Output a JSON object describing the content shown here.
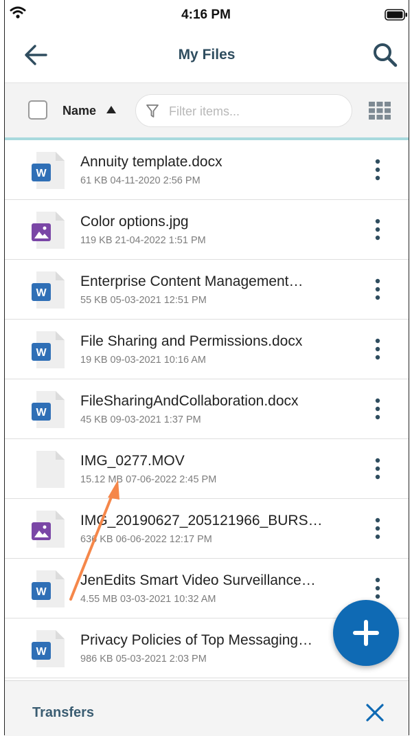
{
  "status_bar": {
    "time": "4:16 PM"
  },
  "header": {
    "title": "My Files"
  },
  "toolbar": {
    "sort_label": "Name",
    "filter_placeholder": "Filter items..."
  },
  "files": [
    {
      "name": "Annuity template.docx",
      "meta": "61 KB 04-11-2020 2:56 PM",
      "icon": "word-doc-icon"
    },
    {
      "name": "Color options.jpg",
      "meta": "119 KB 21-04-2022 1:51 PM",
      "icon": "image-file-icon"
    },
    {
      "name": "Enterprise Content Management…",
      "meta": "55 KB 05-03-2021 12:51 PM",
      "icon": "word-doc-icon"
    },
    {
      "name": "File Sharing and Permissions.docx",
      "meta": "19 KB 09-03-2021 10:16 AM",
      "icon": "word-doc-icon"
    },
    {
      "name": "FileSharingAndCollaboration.docx",
      "meta": "45 KB 09-03-2021 1:37 PM",
      "icon": "word-doc-icon"
    },
    {
      "name": "IMG_0277.MOV",
      "meta": "15.12 MB 07-06-2022 2:45 PM",
      "icon": "generic-file-icon"
    },
    {
      "name": "IMG_20190627_205121966_BURS…",
      "meta": "636 KB 06-06-2022 12:17 PM",
      "icon": "image-file-icon"
    },
    {
      "name": "JenEdits Smart Video Surveillance…",
      "meta": "4.55 MB 03-03-2021 10:32 AM",
      "icon": "word-doc-icon"
    },
    {
      "name": "Privacy Policies of Top Messaging…",
      "meta": "986 KB 05-03-2021 2:03 PM",
      "icon": "word-doc-icon"
    }
  ],
  "footer": {
    "transfers_label": "Transfers"
  },
  "colors": {
    "accent": "#0f6ab4",
    "title": "#2f4d5f",
    "word": "#2f6fb6",
    "image": "#7a46a6",
    "annotation": "#f5874a"
  }
}
